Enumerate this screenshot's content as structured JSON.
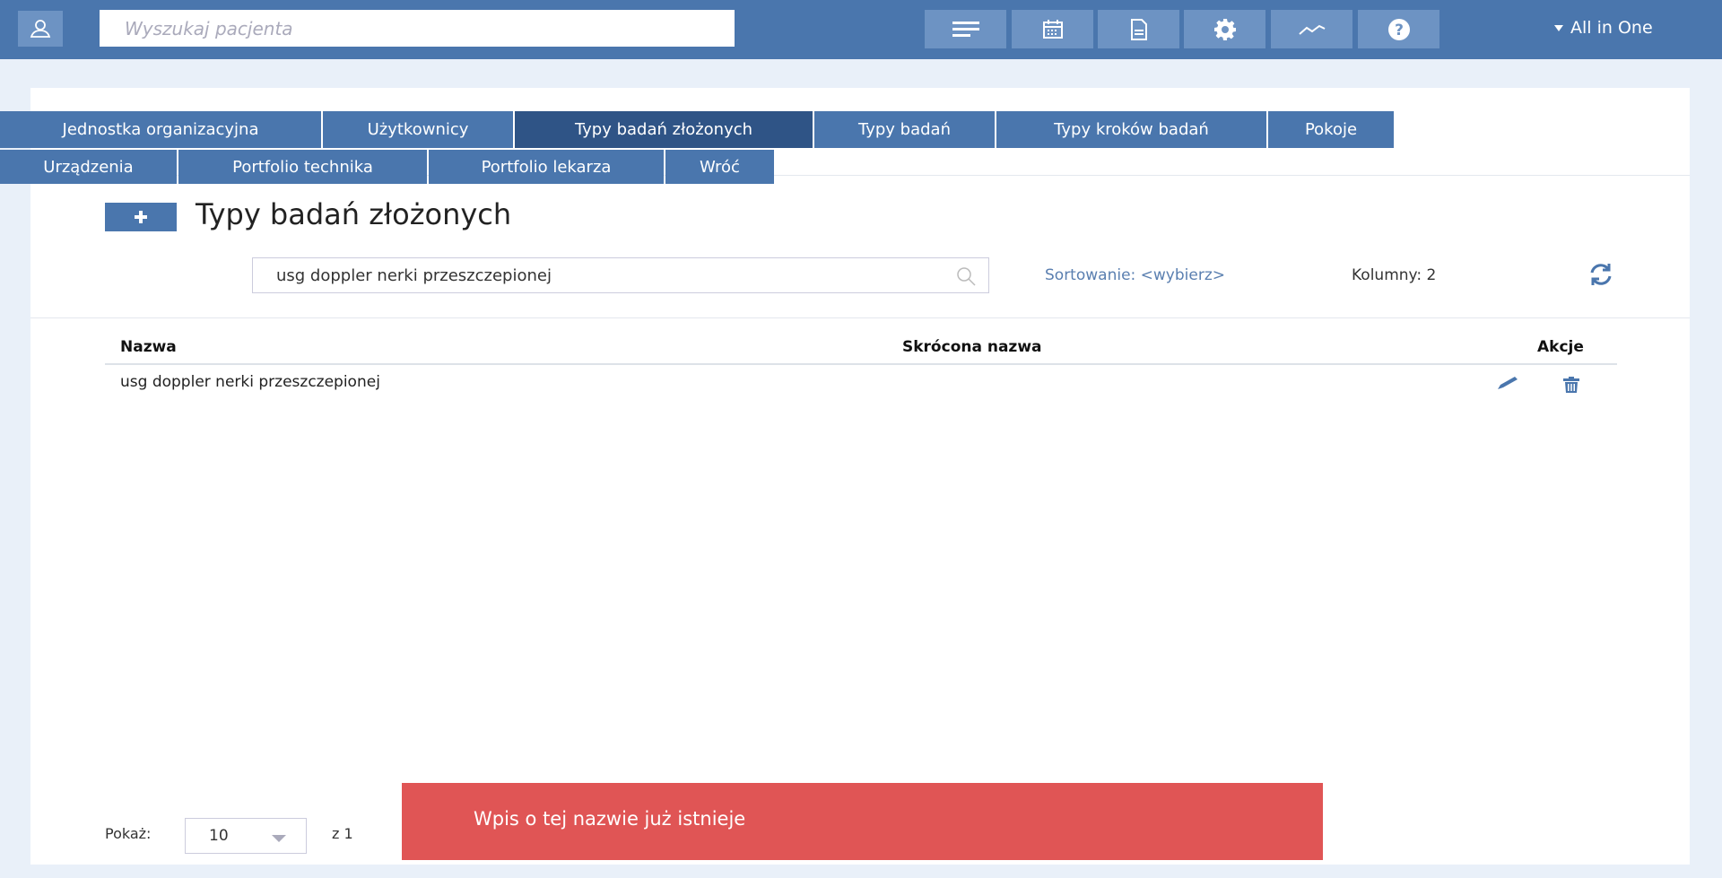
{
  "topbar": {
    "search_placeholder": "Wyszukaj pacjenta",
    "buttons": [
      "list-icon",
      "calendar-icon",
      "document-icon",
      "gear-icon",
      "chart-icon",
      "help-icon"
    ],
    "profile_label": "All in One"
  },
  "tabs": {
    "row1": [
      {
        "label": "Jednostka organizacyjna"
      },
      {
        "label": "Użytkownicy"
      },
      {
        "label": "Typy badań złożonych"
      },
      {
        "label": "Typy badań"
      },
      {
        "label": "Typy kroków badań"
      },
      {
        "label": "Pokoje"
      }
    ],
    "row2": [
      {
        "label": "Urządzenia"
      },
      {
        "label": "Portfolio technika"
      },
      {
        "label": "Portfolio lekarza"
      },
      {
        "label": "Wróć"
      }
    ],
    "active": "Typy badań złożonych"
  },
  "page": {
    "title": "Typy badań złożonych",
    "search_value": "usg doppler nerki przeszczepionej",
    "sort_label": "Sortowanie: <wybierz>",
    "columns_label": "Kolumny: 2"
  },
  "table": {
    "headers": {
      "name": "Nazwa",
      "short_name": "Skrócona nazwa",
      "actions": "Akcje"
    },
    "rows": [
      {
        "name": "usg doppler nerki przeszczepionej",
        "short_name": ""
      }
    ]
  },
  "pagination": {
    "show_label": "Pokaż:",
    "page_size": "10",
    "of_label": "z 1"
  },
  "toast": {
    "message": "Wpis o tej nazwie już istnieje",
    "color": "#e05555"
  },
  "colors": {
    "primary": "#4a76ad",
    "active_tab": "#2f5486",
    "background": "#e9f0f9"
  }
}
